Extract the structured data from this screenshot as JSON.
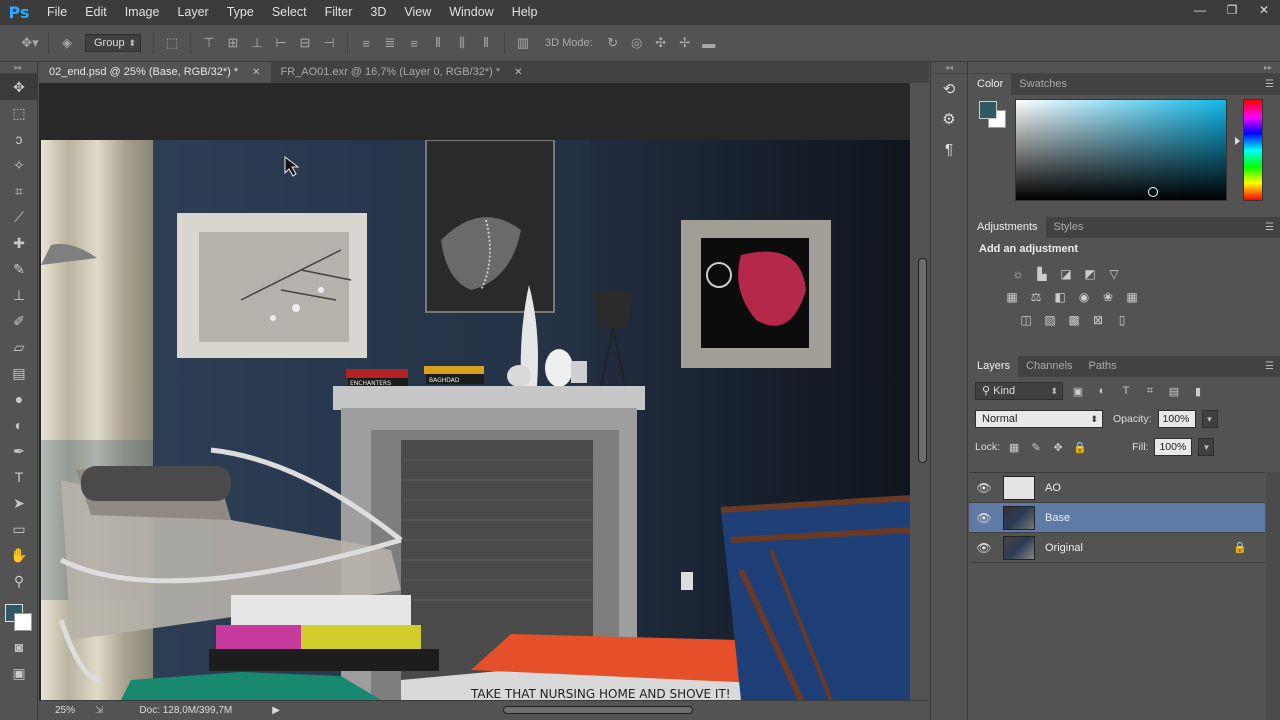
{
  "app": {
    "logo": "Ps"
  },
  "menu": [
    "File",
    "Edit",
    "Image",
    "Layer",
    "Type",
    "Select",
    "Filter",
    "3D",
    "View",
    "Window",
    "Help"
  ],
  "window_controls": [
    "—",
    "❐",
    "✕"
  ],
  "options": {
    "auto_select_value": "Group",
    "mode_label": "3D Mode:"
  },
  "tabs": [
    {
      "label": "02_end.psd @ 25% (Base, RGB/32*) *",
      "close": "✕",
      "active": true
    },
    {
      "label": "FR_AO01.exr @ 16,7% (Layer 0, RGB/32*) *",
      "close": "✕",
      "active": false
    }
  ],
  "status": {
    "zoom": "25%",
    "doc": "Doc: 128,0M/399,7M",
    "arrow": "▶"
  },
  "colors": {
    "foreground": "#2f5a63",
    "background": "#ffffff",
    "accent": "#5f7aa4",
    "ps_blue": "#31a8ff"
  },
  "color_panel": {
    "tabs": [
      "Color",
      "Swatches"
    ]
  },
  "adjustments": {
    "tabs": [
      "Adjustments",
      "Styles"
    ],
    "title": "Add an adjustment"
  },
  "layers": {
    "tabs": [
      "Layers",
      "Channels",
      "Paths"
    ],
    "kind": "Kind",
    "blend_mode": "Normal",
    "opacity_label": "Opacity:",
    "opacity_value": "100%",
    "lock_label": "Lock:",
    "fill_label": "Fill:",
    "fill_value": "100%",
    "items": [
      {
        "name": "AO",
        "selected": false,
        "locked": false
      },
      {
        "name": "Base",
        "selected": true,
        "locked": false
      },
      {
        "name": "Original",
        "selected": false,
        "locked": true
      }
    ]
  },
  "artwork": {
    "book_left_1": "BAGHDAD",
    "book_left_2": "ENCHANTERS",
    "book_right": "MARIMBA",
    "magazine_text": "TAKE THAT NURSING HOME AND SHOVE IT!"
  }
}
